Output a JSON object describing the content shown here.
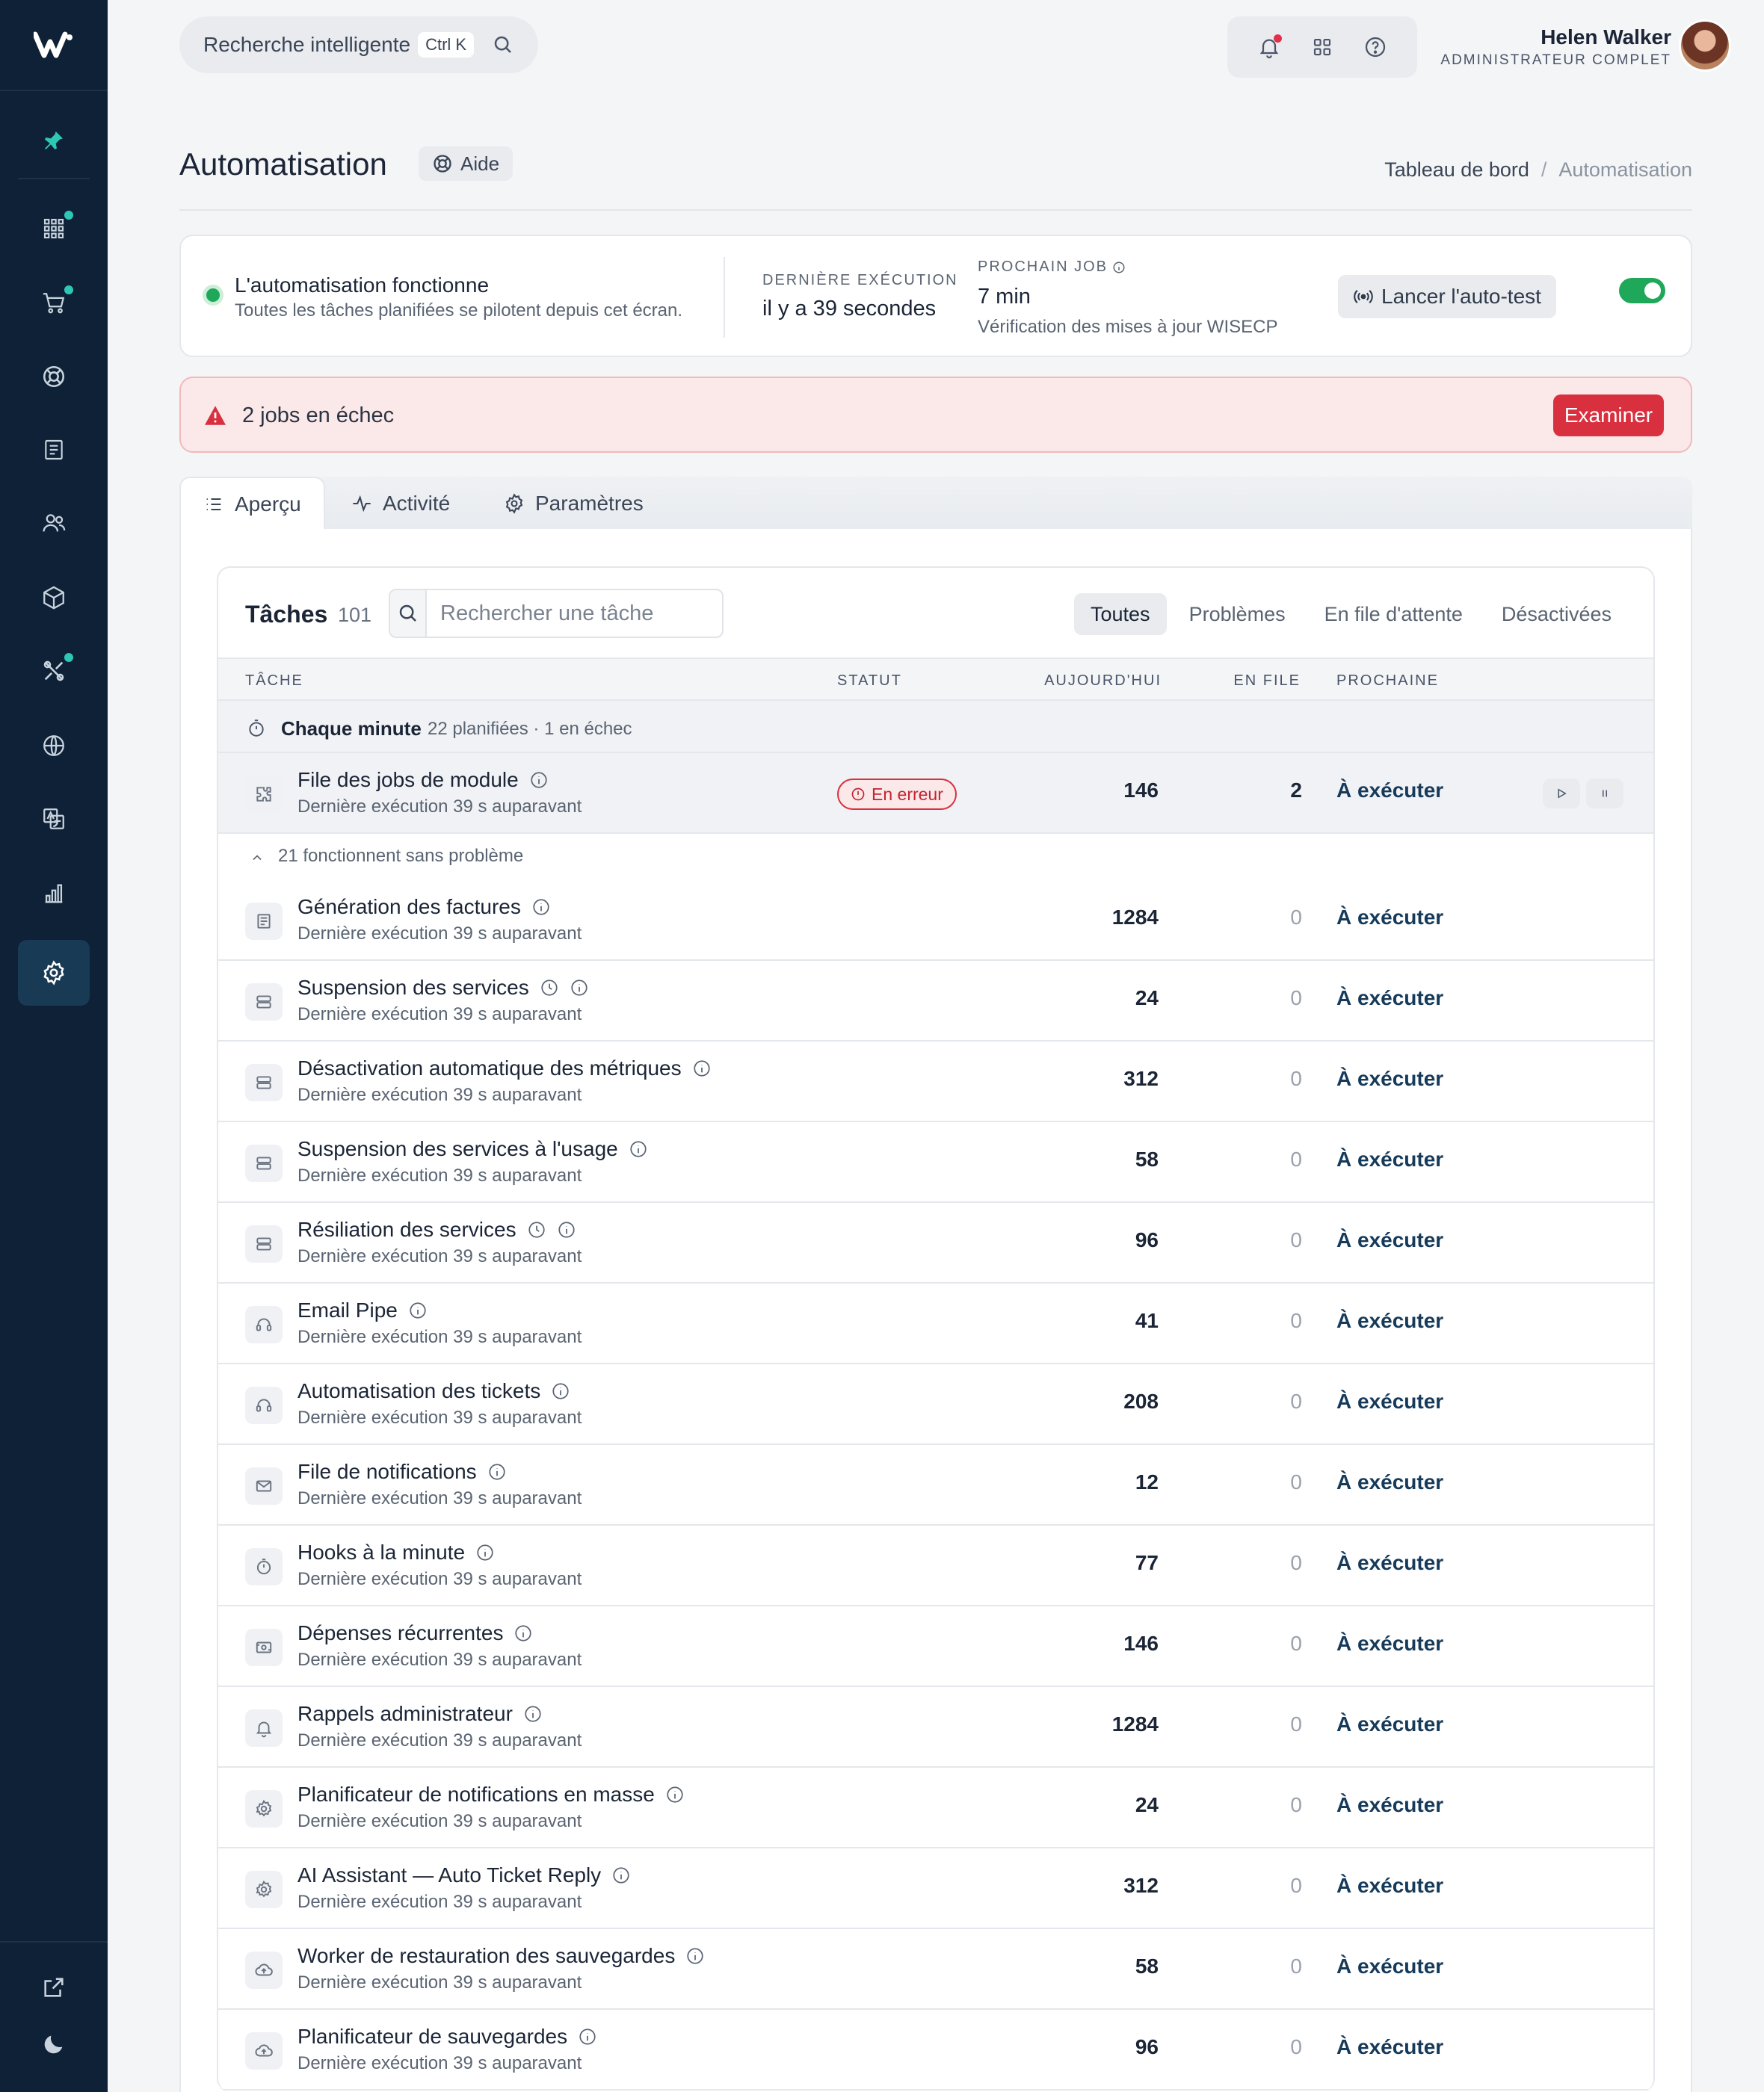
{
  "app": {
    "logo_text": "W"
  },
  "topbar": {
    "search_label": "Recherche intelligente",
    "search_shortcut": "Ctrl K",
    "user_name": "Helen Walker",
    "user_role": "ADMINISTRATEUR COMPLET"
  },
  "sidebar": {
    "items": [
      {
        "icon": "pin-icon"
      },
      {
        "icon": "grid-icon",
        "dot": true
      },
      {
        "icon": "cart-icon",
        "dot": true
      },
      {
        "icon": "lifebuoy-icon"
      },
      {
        "icon": "invoice-icon"
      },
      {
        "icon": "users-icon"
      },
      {
        "icon": "box-icon"
      },
      {
        "icon": "tools-icon",
        "dot": true
      },
      {
        "icon": "globe-icon"
      },
      {
        "icon": "translate-icon"
      },
      {
        "icon": "chart-icon"
      },
      {
        "icon": "settings-icon",
        "active": true
      }
    ],
    "bottom": [
      {
        "icon": "external-link-icon"
      },
      {
        "icon": "moon-icon"
      }
    ]
  },
  "header": {
    "title": "Automatisation",
    "help_label": "Aide",
    "breadcrumb": [
      "Tableau de bord",
      "Automatisation"
    ]
  },
  "status": {
    "title": "L'automatisation fonctionne",
    "subtitle": "Toutes les tâches planifiées se pilotent depuis cet écran.",
    "last_exec_label": "DERNIÈRE EXÉCUTION",
    "last_exec_value": "il y a 39 secondes",
    "next_job_label": "PROCHAIN JOB",
    "next_job_value": "7 min",
    "next_job_desc": "Vérification des mises à jour WISECP",
    "selftest_label": "Lancer l'auto-test",
    "toggle_on": true,
    "color_ok": "#1fa85a"
  },
  "alert": {
    "text": "2 jobs en échec",
    "button": "Examiner",
    "color": "#d9303f"
  },
  "tabs": [
    {
      "label": "Aperçu",
      "icon": "list-icon",
      "active": true
    },
    {
      "label": "Activité",
      "icon": "activity-icon"
    },
    {
      "label": "Paramètres",
      "icon": "gear-icon"
    }
  ],
  "tasks": {
    "title": "Tâches",
    "count": "101",
    "search_placeholder": "Rechercher une tâche",
    "filters": [
      "Toutes",
      "Problèmes",
      "En file d'attente",
      "Désactivées"
    ],
    "columns": [
      "TÂCHE",
      "STATUT",
      "AUJOURD'HUI",
      "EN FILE",
      "PROCHAINE"
    ],
    "group": {
      "name": "Chaque minute",
      "meta": "22 planifiées · 1 en échec"
    },
    "error_row": {
      "name": "File des jobs de module",
      "sub": "Dernière exécution 39 s auparavant",
      "status": "En erreur",
      "today": "146",
      "queue": "2",
      "next": "À exécuter",
      "icon": "puzzle-icon"
    },
    "ok_summary": "21 fonctionnent sans problème",
    "rows": [
      {
        "name": "Génération des factures",
        "sub": "Dernière exécution 39 s auparavant",
        "today": "1284",
        "queue": "0",
        "next": "À exécuter",
        "icon": "invoice-icon",
        "clock": false
      },
      {
        "name": "Suspension des services",
        "sub": "Dernière exécution 39 s auparavant",
        "today": "24",
        "queue": "0",
        "next": "À exécuter",
        "icon": "server-icon",
        "clock": true
      },
      {
        "name": "Désactivation automatique des métriques",
        "sub": "Dernière exécution 39 s auparavant",
        "today": "312",
        "queue": "0",
        "next": "À exécuter",
        "icon": "server-icon",
        "clock": false
      },
      {
        "name": "Suspension des services à l'usage",
        "sub": "Dernière exécution 39 s auparavant",
        "today": "58",
        "queue": "0",
        "next": "À exécuter",
        "icon": "server-icon",
        "clock": false
      },
      {
        "name": "Résiliation des services",
        "sub": "Dernière exécution 39 s auparavant",
        "today": "96",
        "queue": "0",
        "next": "À exécuter",
        "icon": "server-icon",
        "clock": true
      },
      {
        "name": "Email Pipe",
        "sub": "Dernière exécution 39 s auparavant",
        "today": "41",
        "queue": "0",
        "next": "À exécuter",
        "icon": "headset-icon",
        "clock": false
      },
      {
        "name": "Automatisation des tickets",
        "sub": "Dernière exécution 39 s auparavant",
        "today": "208",
        "queue": "0",
        "next": "À exécuter",
        "icon": "headset-icon",
        "clock": false
      },
      {
        "name": "File de notifications",
        "sub": "Dernière exécution 39 s auparavant",
        "today": "12",
        "queue": "0",
        "next": "À exécuter",
        "icon": "mail-icon",
        "clock": false
      },
      {
        "name": "Hooks à la minute",
        "sub": "Dernière exécution 39 s auparavant",
        "today": "77",
        "queue": "0",
        "next": "À exécuter",
        "icon": "timer-icon",
        "clock": false
      },
      {
        "name": "Dépenses récurrentes",
        "sub": "Dernière exécution 39 s auparavant",
        "today": "146",
        "queue": "0",
        "next": "À exécuter",
        "icon": "money-icon",
        "clock": false
      },
      {
        "name": "Rappels administrateur",
        "sub": "Dernière exécution 39 s auparavant",
        "today": "1284",
        "queue": "0",
        "next": "À exécuter",
        "icon": "bell-icon",
        "clock": false
      },
      {
        "name": "Planificateur de notifications en masse",
        "sub": "Dernière exécution 39 s auparavant",
        "today": "24",
        "queue": "0",
        "next": "À exécuter",
        "icon": "gear-icon",
        "clock": false
      },
      {
        "name": "AI Assistant — Auto Ticket Reply",
        "sub": "Dernière exécution 39 s auparavant",
        "today": "312",
        "queue": "0",
        "next": "À exécuter",
        "icon": "gear-icon",
        "clock": false
      },
      {
        "name": "Worker de restauration des sauvegardes",
        "sub": "Dernière exécution 39 s auparavant",
        "today": "58",
        "queue": "0",
        "next": "À exécuter",
        "icon": "cloud-upload-icon",
        "clock": false
      },
      {
        "name": "Planificateur de sauvegardes",
        "sub": "Dernière exécution 39 s auparavant",
        "today": "96",
        "queue": "0",
        "next": "À exécuter",
        "icon": "cloud-upload-icon",
        "clock": false
      }
    ]
  }
}
